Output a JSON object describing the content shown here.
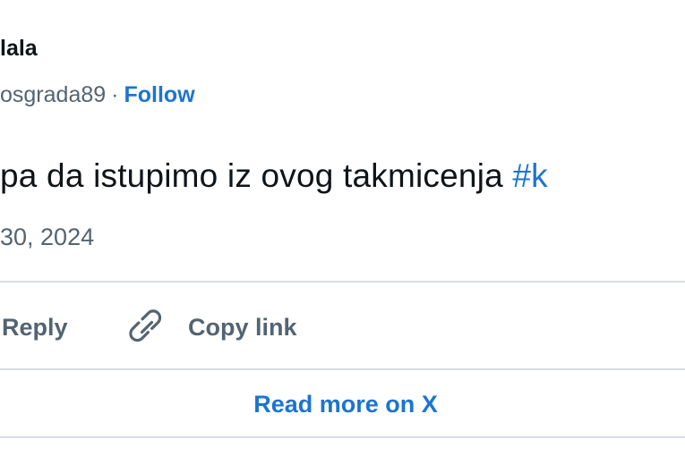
{
  "author": {
    "display_name": "lala",
    "handle": "osgrada89",
    "separator": "·",
    "follow_label": "Follow"
  },
  "tweet": {
    "text": "pa da istupimo iz ovog takmicenja ",
    "hashtag": "#k",
    "date": "30, 2024"
  },
  "actions": {
    "reply_label": "Reply",
    "copy_link_label": "Copy link"
  },
  "footer": {
    "read_more_label": "Read more on X"
  },
  "colors": {
    "link_blue": "#1d74d0",
    "text_primary": "#0f1419",
    "text_secondary": "#536471",
    "divider": "#d7dde2"
  },
  "icons": {
    "copy_link": "link-icon"
  }
}
